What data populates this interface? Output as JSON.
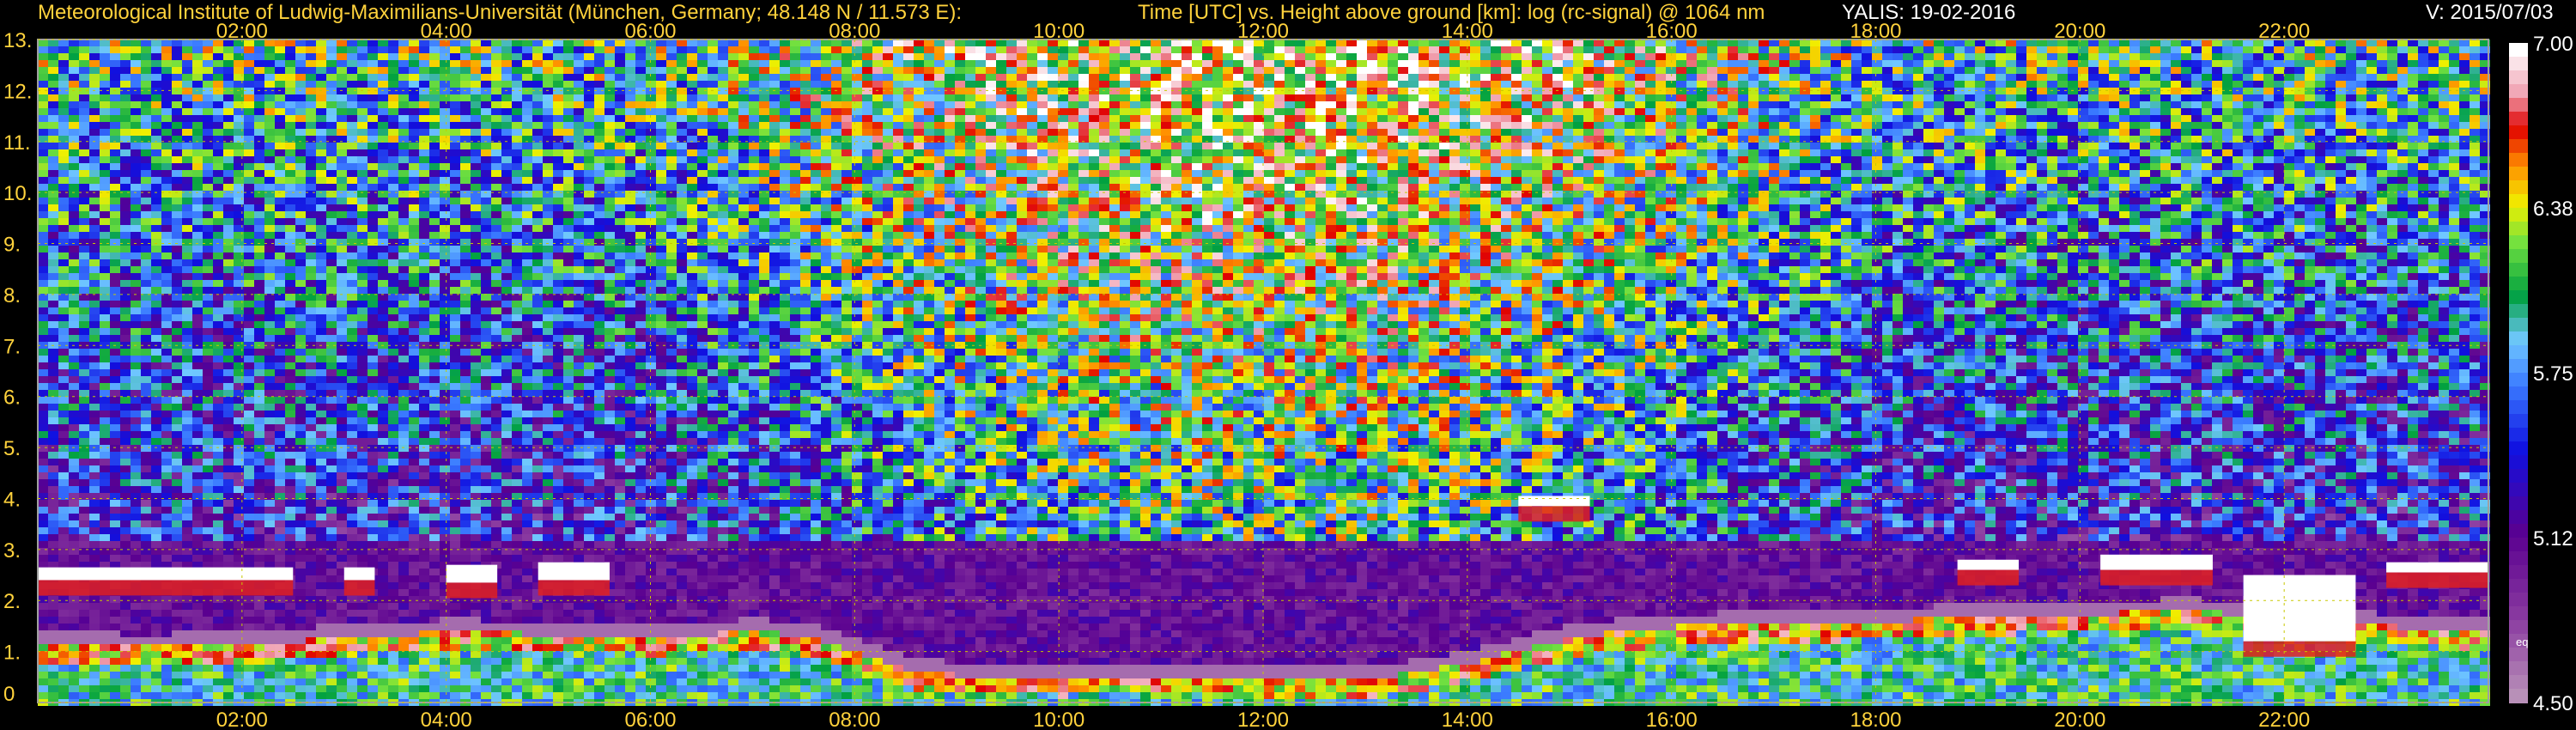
{
  "header": {
    "institute": "Meteorological Institute of Ludwig-Maximilians-Universität (München, Germany; 48.148 N / 11.573 E):",
    "title": "Time [UTC] vs. Height above ground [km]: log (rc-signal) @ 1064 nm",
    "instrument": "YALIS: 19-02-2016",
    "version": "V: 2015/07/03"
  },
  "colors": {
    "text": "#ffd23c",
    "grid": "#c8c800",
    "background": "#000000"
  },
  "chart_data": {
    "type": "heatmap",
    "title": "Time [UTC] vs. Height above ground [km]: log (rc-signal) @ 1064 nm",
    "xlabel": "Time [UTC]",
    "ylabel": "Height above ground [km]",
    "x_ticks": [
      "02:00",
      "04:00",
      "06:00",
      "08:00",
      "10:00",
      "12:00",
      "14:00",
      "16:00",
      "18:00",
      "20:00",
      "22:00"
    ],
    "x_tick_hours": [
      2,
      4,
      6,
      8,
      10,
      12,
      14,
      16,
      18,
      20,
      22
    ],
    "xlim_hours": [
      0,
      24
    ],
    "y_ticks": [
      "0",
      "1.",
      "2.",
      "3.",
      "4.",
      "5.",
      "6.",
      "7.",
      "8.",
      "9.",
      "10.",
      "11.",
      "12.",
      "13."
    ],
    "ylim_km": [
      0,
      13
    ],
    "grid": true,
    "colorbar": {
      "ticks": [
        "7.00",
        "6.38",
        "5.75",
        "5.12",
        "4.50"
      ],
      "range": [
        4.5,
        7.0
      ],
      "note": "eq"
    },
    "features": {
      "boundary_layer_top_km": [
        [
          0.0,
          1.35
        ],
        [
          1.0,
          1.3
        ],
        [
          2.0,
          1.35
        ],
        [
          3.0,
          1.5
        ],
        [
          4.0,
          1.6
        ],
        [
          5.0,
          1.55
        ],
        [
          6.0,
          1.5
        ],
        [
          7.0,
          1.6
        ],
        [
          7.5,
          1.5
        ],
        [
          8.0,
          1.2
        ],
        [
          8.5,
          0.85
        ],
        [
          9.0,
          0.75
        ],
        [
          10.0,
          0.7
        ],
        [
          11.0,
          0.75
        ],
        [
          12.0,
          0.7
        ],
        [
          13.0,
          0.65
        ],
        [
          14.0,
          1.0
        ],
        [
          15.0,
          1.5
        ],
        [
          16.0,
          1.7
        ],
        [
          17.0,
          1.75
        ],
        [
          18.0,
          1.8
        ],
        [
          19.0,
          1.9
        ],
        [
          20.0,
          1.95
        ],
        [
          21.0,
          2.0
        ],
        [
          22.0,
          1.9
        ],
        [
          23.0,
          1.7
        ],
        [
          24.0,
          1.6
        ]
      ],
      "cloud_layers": [
        {
          "start_h": 0.0,
          "end_h": 2.5,
          "base_km": 2.4,
          "top_km": 2.65
        },
        {
          "start_h": 3.0,
          "end_h": 3.3,
          "base_km": 2.4,
          "top_km": 2.65
        },
        {
          "start_h": 4.0,
          "end_h": 4.5,
          "base_km": 2.35,
          "top_km": 2.7
        },
        {
          "start_h": 4.9,
          "end_h": 5.6,
          "base_km": 2.4,
          "top_km": 2.75
        },
        {
          "start_h": 14.5,
          "end_h": 15.2,
          "base_km": 3.85,
          "top_km": 4.05
        },
        {
          "start_h": 18.8,
          "end_h": 19.4,
          "base_km": 2.6,
          "top_km": 2.8
        },
        {
          "start_h": 20.2,
          "end_h": 21.3,
          "base_km": 2.6,
          "top_km": 2.9
        },
        {
          "start_h": 21.6,
          "end_h": 22.7,
          "base_km": 1.2,
          "top_km": 2.5
        },
        {
          "start_h": 23.0,
          "end_h": 24.0,
          "base_km": 2.55,
          "top_km": 2.75
        }
      ]
    }
  }
}
